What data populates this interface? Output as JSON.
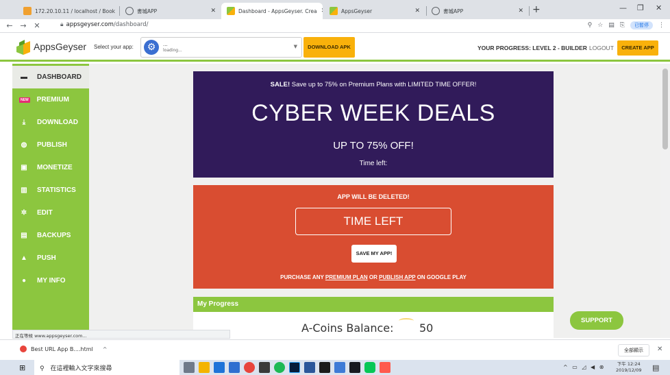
{
  "browser": {
    "tabs": [
      {
        "label": "172.20.10.11 / localhost / Book",
        "icon": "phpmyadmin-icon"
      },
      {
        "label": "書城APP",
        "icon": "globe-icon"
      },
      {
        "label": "Dashboard - AppsGeyser. Crea",
        "icon": "appsgeyser-icon"
      },
      {
        "label": "AppsGeyser",
        "icon": "appsgeyser-icon"
      },
      {
        "label": "書城APP",
        "icon": "globe-icon"
      }
    ],
    "url_host": "appsgeyser.com",
    "url_path": "/dashboard/",
    "profile_label": "已暫停"
  },
  "header": {
    "brand": "AppsGeyser",
    "select_label": "Select your app:",
    "selected_app_name": "...",
    "selected_app_status": "loading...",
    "download_apk": "DOWNLOAD APK",
    "progress": "YOUR PROGRESS: LEVEL 2 - BUILDER",
    "logout": "LOGOUT",
    "create_app": "CREATE APP"
  },
  "sidebar": {
    "items": [
      {
        "label": "DASHBOARD",
        "icon": "dashboard-icon",
        "glyph": "▬"
      },
      {
        "label": "PREMIUM",
        "icon": "new-badge",
        "glyph": "NEW"
      },
      {
        "label": "DOWNLOAD",
        "icon": "download-icon",
        "glyph": "⤓"
      },
      {
        "label": "PUBLISH",
        "icon": "globe-icon",
        "glyph": "◍"
      },
      {
        "label": "MONETIZE",
        "icon": "money-icon",
        "glyph": "▣"
      },
      {
        "label": "STATISTICS",
        "icon": "chart-icon",
        "glyph": "▥"
      },
      {
        "label": "EDIT",
        "icon": "gears-icon",
        "glyph": "✲"
      },
      {
        "label": "BACKUPS",
        "icon": "save-icon",
        "glyph": "▤"
      },
      {
        "label": "PUSH",
        "icon": "bell-icon",
        "glyph": "▲"
      },
      {
        "label": "MY INFO",
        "icon": "user-icon",
        "glyph": "●"
      }
    ]
  },
  "promo": {
    "sale_bold": "SALE!",
    "sale_text": " Save up to 75% on Premium Plans with LIMITED TIME OFFER!",
    "headline": "CYBER WEEK DEALS",
    "discount": "UP TO 75% OFF!",
    "time_left": "Time left:"
  },
  "warning": {
    "title": "APP WILL BE DELETED!",
    "time_box": "TIME LEFT",
    "save_button": "SAVE MY APP!",
    "purchase_prefix": "PURCHASE ANY ",
    "premium_link": "PREMIUM PLAN",
    "purchase_or": " OR ",
    "publish_link": "PUBLISH APP",
    "purchase_suffix": " ON GOOGLE PLAY"
  },
  "progress_card": {
    "title": "My Progress",
    "coins_label": "A-Coins Balance:",
    "coins_value": "50"
  },
  "support": "SUPPORT",
  "status_url": "正在等候 www.appsgeyser.com...",
  "downloads": {
    "file": "Best URL App B....html",
    "show_all": "全部顯示"
  },
  "taskbar": {
    "search_placeholder": "在這裡輸入文字來搜尋",
    "time": "下午 12:24",
    "date": "2019/12/09"
  },
  "colors": {
    "brand_green": "#8cc63f",
    "accent_orange": "#f9b10b",
    "promo_purple": "#311b5a",
    "warning_red": "#d94d31"
  }
}
